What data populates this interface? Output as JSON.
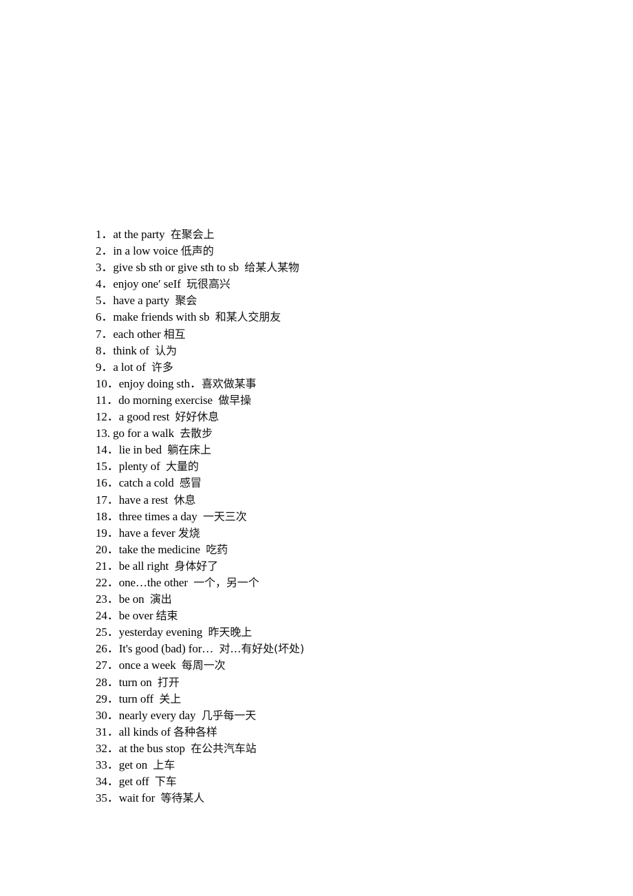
{
  "document": {
    "phrases": [
      {
        "num": "1．",
        "en": "at the party  ",
        "zh": "在聚会上"
      },
      {
        "num": "2．",
        "en": "in a low voice ",
        "zh": "低声的"
      },
      {
        "num": "3．",
        "en": "give sb sth or give sth to sb  ",
        "zh": "给某人某物"
      },
      {
        "num": "4．",
        "en": "enjoy one′ seIf  ",
        "zh": "玩很高兴"
      },
      {
        "num": "5．",
        "en": "have a party  ",
        "zh": "聚会"
      },
      {
        "num": "6．",
        "en": "make friends with sb  ",
        "zh": "和某人交朋友"
      },
      {
        "num": "7．",
        "en": "each other ",
        "zh": "相互"
      },
      {
        "num": "8．",
        "en": "think of  ",
        "zh": "认为"
      },
      {
        "num": "9．",
        "en": "a lot of  ",
        "zh": "许多"
      },
      {
        "num": "10．",
        "en": "enjoy doing sth．",
        "zh": "喜欢做某事"
      },
      {
        "num": "11．",
        "en": "do morning exercise  ",
        "zh": "做早操"
      },
      {
        "num": "12．",
        "en": "a good rest  ",
        "zh": "好好休息"
      },
      {
        "num": "13. ",
        "en": "go for a walk  ",
        "zh": "去散步"
      },
      {
        "num": "14．",
        "en": "lie in bed  ",
        "zh": "躺在床上"
      },
      {
        "num": "15．",
        "en": "plenty of  ",
        "zh": "大量的"
      },
      {
        "num": "16．",
        "en": "catch a cold  ",
        "zh": "感冒"
      },
      {
        "num": "17．",
        "en": "have a rest  ",
        "zh": "休息"
      },
      {
        "num": "18．",
        "en": "three times a day  ",
        "zh": "一天三次"
      },
      {
        "num": "19．",
        "en": "have a fever ",
        "zh": "发烧"
      },
      {
        "num": "20．",
        "en": "take the medicine  ",
        "zh": "吃药"
      },
      {
        "num": "21．",
        "en": "be all right  ",
        "zh": "身体好了"
      },
      {
        "num": "22．",
        "en": "one…the other  ",
        "zh": "一个，另一个"
      },
      {
        "num": "23．",
        "en": "be on  ",
        "zh": "演出"
      },
      {
        "num": "24．",
        "en": "be over ",
        "zh": "结束"
      },
      {
        "num": "25．",
        "en": "yesterday evening  ",
        "zh": "昨天晚上"
      },
      {
        "num": "26．",
        "en": "It's good (bad) for…  ",
        "zh": "对…有好处(坏处)"
      },
      {
        "num": "27．",
        "en": "once a week  ",
        "zh": "每周一次"
      },
      {
        "num": "28．",
        "en": "turn on  ",
        "zh": "打开"
      },
      {
        "num": "29．",
        "en": "turn off  ",
        "zh": "关上"
      },
      {
        "num": "30．",
        "en": "nearly every day  ",
        "zh": "几乎每一天"
      },
      {
        "num": "31．",
        "en": "all kinds of ",
        "zh": "各种各样"
      },
      {
        "num": "32．",
        "en": "at the bus stop  ",
        "zh": "在公共汽车站"
      },
      {
        "num": "33．",
        "en": "get on  ",
        "zh": "上车"
      },
      {
        "num": "34．",
        "en": "get off  ",
        "zh": "下车"
      },
      {
        "num": "35．",
        "en": "wait for  ",
        "zh": "等待某人"
      }
    ]
  }
}
